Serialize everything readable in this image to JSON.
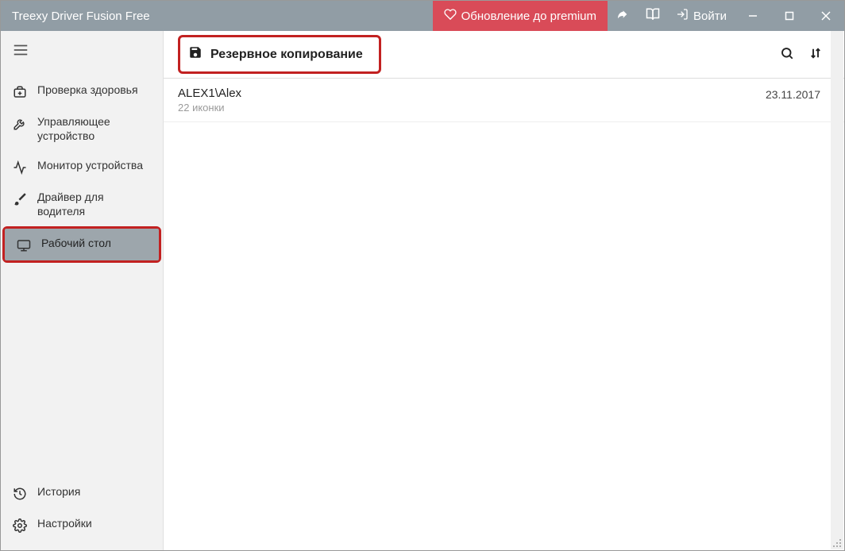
{
  "titlebar": {
    "app_title": "Treexy Driver Fusion Free",
    "premium_label": "Обновление до premium",
    "login_label": "Войти"
  },
  "sidebar": {
    "items": [
      {
        "label": "Проверка здоровья"
      },
      {
        "label": "Управляющее устройство"
      },
      {
        "label": "Монитор устройства"
      },
      {
        "label": "Драйвер для водителя"
      },
      {
        "label": "Рабочий стол"
      }
    ],
    "bottom": [
      {
        "label": "История"
      },
      {
        "label": "Настройки"
      }
    ]
  },
  "main": {
    "page_title": "Резервное копирование",
    "rows": [
      {
        "title": "ALEX1\\Alex",
        "subtitle": "22 иконки",
        "date": "23.11.2017"
      }
    ]
  }
}
